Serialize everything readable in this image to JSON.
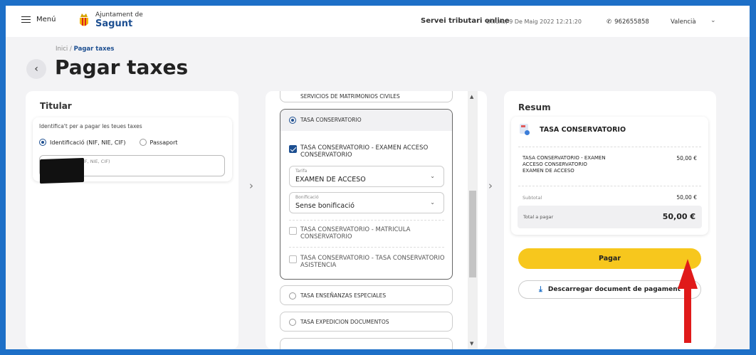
{
  "header": {
    "menu_label": "Menú",
    "logo_line1": "Ajuntament de",
    "logo_line2": "Sagunt",
    "service": "Servei tributari online",
    "datetime": "Dilluns, 9 De Maig 2022 12:21:20",
    "phone": "962655858",
    "language": "Valencià"
  },
  "breadcrumb": {
    "home": "Inici",
    "separator": "/",
    "current": "Pagar taxes"
  },
  "page_title": "Pagar taxes",
  "titular": {
    "heading": "Titular",
    "description": "Identifica't per a pagar les teues taxes",
    "option_id": "Identificació (NIF, NIE, CIF)",
    "option_passport": "Passaport",
    "field_label": "Identificació (NIF, NIE, CIF)"
  },
  "services": {
    "top_item": "SERVICIOS DE MATRIMONIOS CIVILES",
    "expanded": {
      "label": "TASA CONSERVATORIO",
      "sub1": "TASA CONSERVATORIO - EXAMEN ACCESO CONSERVATORIO",
      "tarifa_label": "Tarifa",
      "tarifa_value": "EXAMEN DE ACCESO",
      "bonif_label": "Bonificació",
      "bonif_value": "Sense bonificació",
      "sub2": "TASA CONSERVATORIO - MATRICULA CONSERVATORIO",
      "sub3": "TASA CONSERVATORIO - TASA CONSERVATORIO ASISTENCIA"
    },
    "item_ensenanzas": "TASA ENSEÑANZAS ESPECIALES",
    "item_expedicion": "TASA EXPEDICION DOCUMENTOS"
  },
  "resum": {
    "heading": "Resum",
    "card_title": "TASA CONSERVATORIO",
    "line_desc_1": "TASA CONSERVATORIO - EXAMEN",
    "line_desc_2": "ACCESO CONSERVATORIO",
    "line_desc_3": "EXAMEN DE ACCESO",
    "line_amount": "50,00 €",
    "subtotal_label": "Subtotal",
    "subtotal_amount": "50,00 €",
    "total_label": "Total a pagar",
    "total_amount": "50,00 €",
    "pay_button": "Pagar",
    "download_button": "Descarregar document de pagament"
  },
  "colors": {
    "brand_blue": "#1d4f91",
    "pay_yellow": "#f7c71d",
    "border_blue": "#1d6fc7",
    "annotation_red": "#e01a1a"
  }
}
